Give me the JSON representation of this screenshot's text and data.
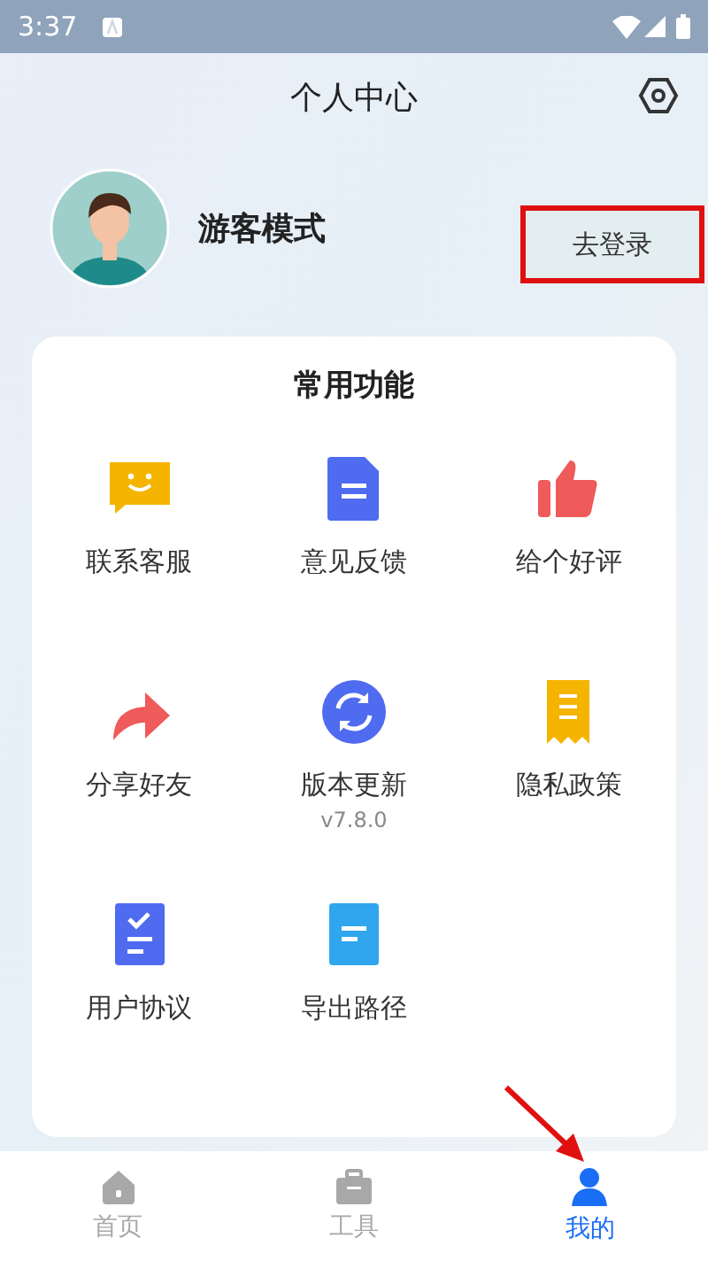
{
  "status_bar": {
    "time": "3:37"
  },
  "header": {
    "title": "个人中心"
  },
  "profile": {
    "name": "游客模式",
    "login_button": "去登录",
    "highlighted": true
  },
  "functions": {
    "title": "常用功能",
    "items": [
      {
        "label": "联系客服"
      },
      {
        "label": "意见反馈"
      },
      {
        "label": "给个好评"
      },
      {
        "label": "分享好友"
      },
      {
        "label": "版本更新",
        "subtitle": "v7.8.0"
      },
      {
        "label": "隐私政策"
      },
      {
        "label": "用户协议"
      },
      {
        "label": "导出路径"
      }
    ]
  },
  "tab_bar": [
    {
      "label": "首页",
      "selected": false
    },
    {
      "label": "工具",
      "selected": false
    },
    {
      "label": "我的",
      "selected": true
    }
  ]
}
